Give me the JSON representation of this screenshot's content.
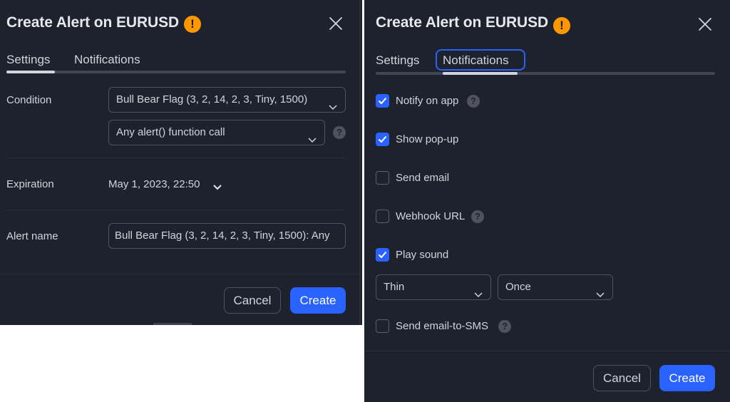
{
  "left": {
    "title": "Create Alert on EURUSD",
    "tabs": [
      "Settings",
      "Notifications"
    ],
    "condition_label": "Condition",
    "condition_value": "Bull Bear Flag (3, 2, 14, 2, 3, Tiny, 1500)",
    "trigger_value": "Any alert() function call",
    "expiration_label": "Expiration",
    "expiration_value": "May 1, 2023, 22:50",
    "alert_name_label": "Alert name",
    "alert_name_value": "Bull Bear Flag (3, 2, 14, 2, 3, Tiny, 1500): Any",
    "cancel_label": "Cancel",
    "create_label": "Create"
  },
  "right": {
    "title": "Create Alert on EURUSD",
    "tabs": [
      "Settings",
      "Notifications"
    ],
    "options": [
      {
        "label": "Notify on app",
        "checked": true,
        "help": true
      },
      {
        "label": "Show pop-up",
        "checked": true,
        "help": false
      },
      {
        "label": "Send email",
        "checked": false,
        "help": false
      },
      {
        "label": "Webhook URL",
        "checked": false,
        "help": true
      },
      {
        "label": "Play sound",
        "checked": true,
        "help": false
      },
      {
        "label": "Send email-to-SMS",
        "checked": false,
        "help": true
      }
    ],
    "sound_value": "Thin",
    "repeat_value": "Once",
    "cancel_label": "Cancel",
    "create_label": "Create"
  },
  "colors": {
    "panel_bg": "#1e222d",
    "accent": "#2962ff",
    "warning": "#ff9800",
    "text": "#d1d4dc"
  },
  "icons": {
    "warning": "exclamation-circle",
    "close": "x-mark",
    "help": "question-circle",
    "dropdown": "chevron-down",
    "check": "checkmark"
  }
}
